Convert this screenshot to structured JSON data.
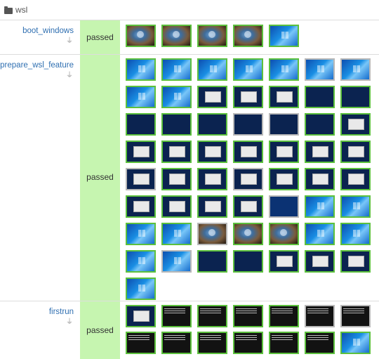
{
  "header": {
    "title": "wsl"
  },
  "rows": [
    {
      "module": "boot_windows",
      "result": "passed"
    },
    {
      "module": "prepare_wsl_feature",
      "result": "passed"
    },
    {
      "module": "firstrun",
      "result": "passed"
    }
  ],
  "screens": {
    "boot_windows": [
      "t-login",
      "t-login",
      "t-login",
      "t-login",
      "t-win"
    ],
    "prepare_wsl_feature": [
      "t-win",
      "t-win",
      "t-win",
      "t-win",
      "t-win",
      "t-win",
      "t-win",
      "t-win",
      "t-win",
      "t-dlg",
      "t-dlg",
      "t-dlg",
      "t-dark",
      "t-dark",
      "t-dark",
      "t-dark",
      "t-dark",
      "t-dark",
      "t-dark",
      "t-dark",
      "t-dlg",
      "t-dlg",
      "t-dlg",
      "t-dlg",
      "t-dlg",
      "t-dlg",
      "t-dlg",
      "t-dlg",
      "t-dlg",
      "t-dlg",
      "t-dlg",
      "t-dlg",
      "t-dlg",
      "t-dlg",
      "t-dlg",
      "t-dlg",
      "t-dlg",
      "t-dlg",
      "t-dlg",
      "t-blue",
      "t-win",
      "t-win",
      "t-win",
      "t-win",
      "t-login",
      "t-login",
      "t-login",
      "t-win",
      "t-win",
      "t-win",
      "t-win",
      "t-dark",
      "t-dark",
      "t-dlg",
      "t-dlg",
      "t-dlg",
      "t-win"
    ],
    "firstrun": [
      "t-dlg",
      "t-term",
      "t-term",
      "t-term",
      "t-term",
      "t-term",
      "t-term",
      "t-term",
      "t-term",
      "t-term",
      "t-term",
      "t-term",
      "t-term",
      "t-win"
    ]
  }
}
